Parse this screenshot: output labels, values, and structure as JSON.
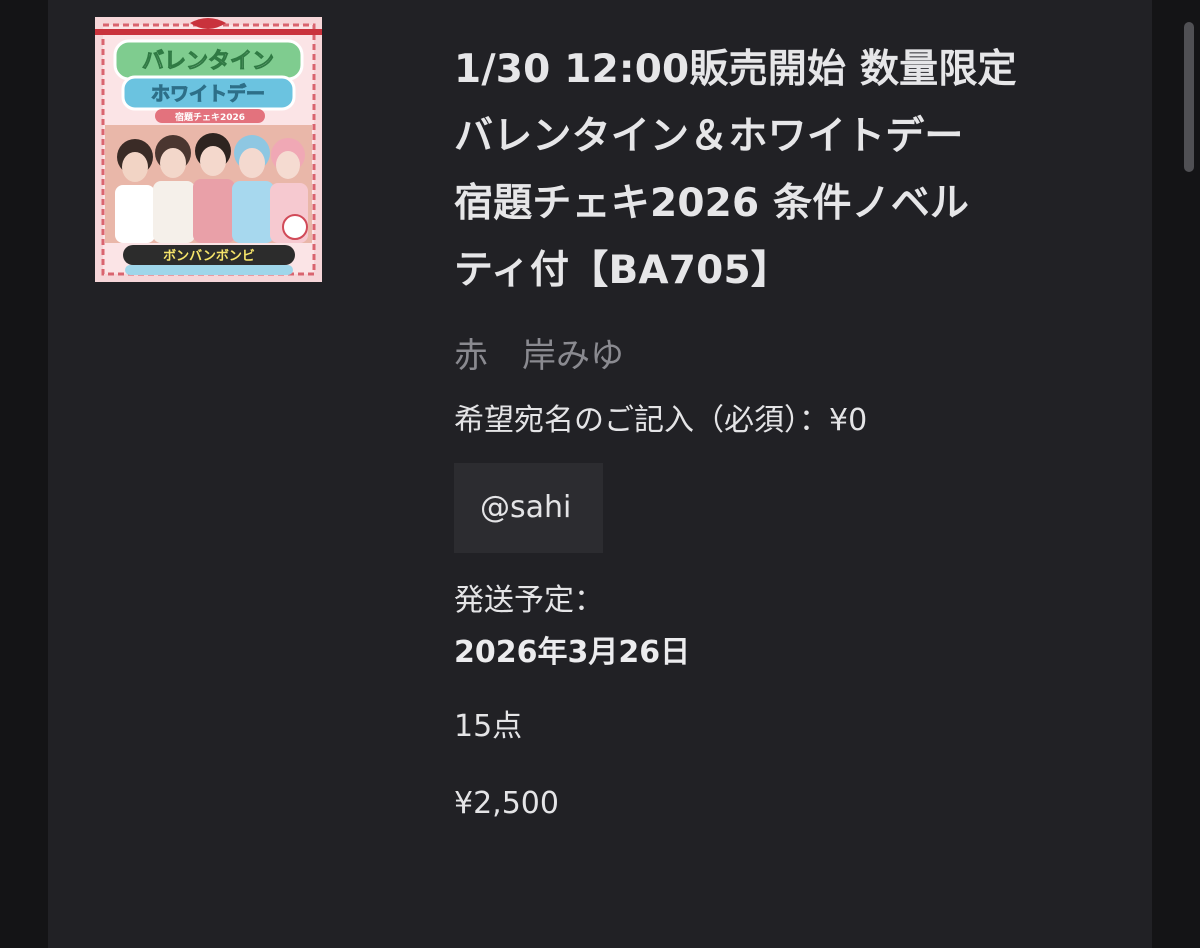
{
  "product": {
    "image_alt": "バレンタインホワイトデー 宿題チェキ",
    "image_text": {
      "line1": "バレンタイン",
      "line2": "ホワイトデー",
      "line3": "宿題チェキ2026",
      "bottom": "ボンバンボンビ"
    },
    "title_lines": [
      "1/30 12:00販売開始 数量限定",
      "バレンタイン＆ホワイトデー",
      "宿題チェキ2026 条件ノベル",
      "ティ付【BA705】"
    ],
    "artist": "赤　岸みゆ",
    "option_label": "希望宛名のご記入（必須）：¥0",
    "option_value": "@sahi",
    "shipping_label": "発送予定：",
    "shipping_date": "2026年3月26日",
    "quantity": "15点",
    "price": "¥2,500"
  },
  "colors": {
    "background": "#141416",
    "panel": "#212125",
    "text": "#e4e4e6",
    "muted_text": "#8a8a90",
    "input_bg": "#2c2c30"
  }
}
